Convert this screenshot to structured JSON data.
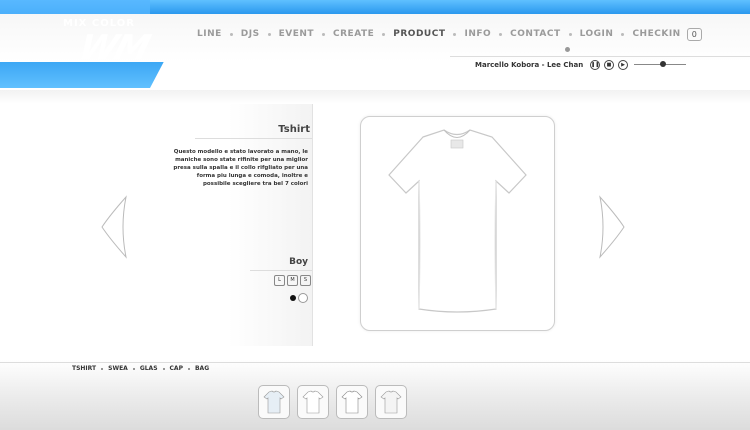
{
  "brand": {
    "small_title": "MIX COLOR",
    "mark": "WM",
    "badge": ""
  },
  "nav": {
    "items": [
      "LINE",
      "DJS",
      "EVENT",
      "CREATE",
      "PRODUCT",
      "INFO",
      "CONTACT",
      "LOGIN",
      "CHECKIN"
    ],
    "active": "PRODUCT",
    "cart_count": "0"
  },
  "music": {
    "track": "Marcello Kobora - Lee Chan",
    "icons": [
      "pause-icon",
      "stop-icon",
      "play-icon"
    ],
    "volume_fraction": 0.55
  },
  "product": {
    "title": "Tshirt",
    "description": "Questo modello e stato lavorato a mano, le maniche sono state rifinite per una miglior presa sulla spalla e il collo rifgliato per una forma piu lunga e comoda, inoltre e possibile scegliere tra bel 7 colori",
    "gender": "Boy",
    "sizes": [
      "L",
      "M",
      "S"
    ],
    "colors": [
      "#111111",
      "#ffffff"
    ]
  },
  "categories": [
    "TSHIRT",
    "SWEA",
    "GLAS",
    "CAP",
    "BAG"
  ],
  "thumbnails": [
    "tshirt-thumb-1",
    "tshirt-thumb-2",
    "tshirt-thumb-3",
    "tshirt-thumb-4"
  ]
}
